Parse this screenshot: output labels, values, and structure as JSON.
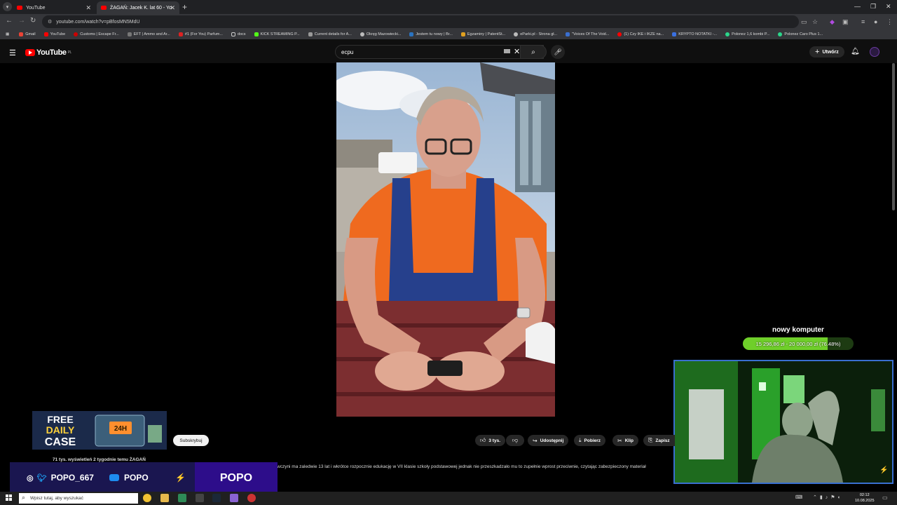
{
  "browser": {
    "tabs": [
      {
        "label": "YouTube"
      },
      {
        "label": "ŻAGAŃ: Jacek K. lat 60 - Yo"
      }
    ],
    "url": "youtube.com/watch?v=pBfosMN5MdU",
    "bookmarks": [
      "Gmail",
      "YouTube",
      "Customs | Escape Fr...",
      "EFT | Ammo and Ar...",
      "#1 (For You) Parfum...",
      "docs",
      "KICK STREAMING P...",
      "Current details for A...",
      "Okręg Mazowiecki...",
      "Jestem tu nowy | Br...",
      "Egzaminy | PatentSt...",
      "eParki.pl - Strona gł...",
      "\"Voices Of The Void...",
      "(1) Czy IKE i IKZE na...",
      "KRYPTO NOTATKI -...",
      "Polonez 1,6 kombi P...",
      "Polonez Caro Plus 1..."
    ]
  },
  "youtube": {
    "logo": "YouTube",
    "region": "PL",
    "search_value": "ecpu",
    "create_label": "Utwórz"
  },
  "video": {
    "subscribe_label": "Subskrybuj",
    "like_count": "3 tys.",
    "share_label": "Udostępnij",
    "download_label": "Pobierz",
    "clip_label": "Klip",
    "save_label": "Zapisz",
    "meta": "71 tys. wyświetleń  2 tygodnie temu  ŻAGAŃ",
    "description": "wczyni ma zaledwie 13 lat i wkrótce rozpocznie edukację w VII klasie szkoły podstawowej jednak nie przeszkadzało mu to zupełnie wprost przeciwnie, czytając zabezpieczony materiał"
  },
  "overlay": {
    "goal_title": "nowy komputer",
    "goal_text": "15 296,86 zł - 20 000,00 zł (76.48%)",
    "goal_fraction": 0.7648,
    "case_line1": "FREE",
    "case_line2": "DAILY",
    "case_line3": "CASE",
    "case_badge": "24H",
    "social_instagram_twitter": "POPO_667",
    "social_youtube": "POPO",
    "social_main": "POPO"
  },
  "taskbar": {
    "search_placeholder": "Wpisz tutaj, aby wyszukać",
    "time": "02:12",
    "date": "10.08.2025"
  }
}
